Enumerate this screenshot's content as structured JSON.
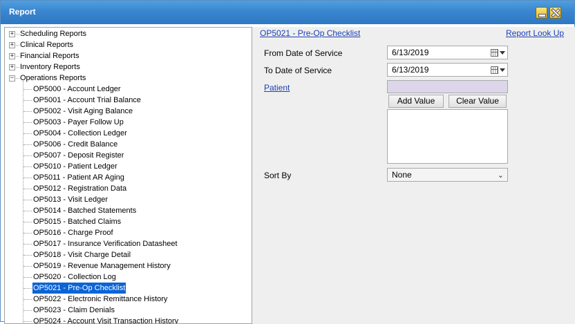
{
  "window": {
    "title": "Report"
  },
  "tree": {
    "top_level": [
      {
        "label": "Scheduling Reports",
        "expanded": false
      },
      {
        "label": "Clinical Reports",
        "expanded": false
      },
      {
        "label": "Financial Reports",
        "expanded": false
      },
      {
        "label": "Inventory Reports",
        "expanded": false
      },
      {
        "label": "Operations Reports",
        "expanded": true
      }
    ],
    "operations_children": [
      "OP5000 - Account Ledger",
      "OP5001 - Account Trial Balance",
      "OP5002 - Visit Aging Balance",
      "OP5003 - Payer Follow Up",
      "OP5004 - Collection Ledger",
      "OP5006 - Credit Balance",
      "OP5007 - Deposit Register",
      "OP5010 - Patient Ledger",
      "OP5011 - Patient AR Aging",
      "OP5012 - Registration Data",
      "OP5013 - Visit Ledger",
      "OP5014 - Batched Statements",
      "OP5015 - Batched Claims",
      "OP5016 - Charge Proof",
      "OP5017 - Insurance Verification Datasheet",
      "OP5018 - Visit Charge Detail",
      "OP5019 - Revenue Management History",
      "OP5020 - Collection Log",
      "OP5021 - Pre-Op Checklist",
      "OP5022 - Electronic Remittance History",
      "OP5023 - Claim Denials",
      "OP5024 - Account Visit Transaction History"
    ],
    "selected": "OP5021 - Pre-Op Checklist"
  },
  "report": {
    "title_link": "OP5021 - Pre-Op Checklist",
    "lookup_link": "Report Look Up",
    "from_label": "From Date of Service",
    "from_value": "6/13/2019",
    "to_label": "To Date of Service",
    "to_value": "6/13/2019",
    "patient_link": "Patient",
    "add_value": "Add Value",
    "clear_value": "Clear Value",
    "sort_label": "Sort By",
    "sort_value": "None"
  }
}
